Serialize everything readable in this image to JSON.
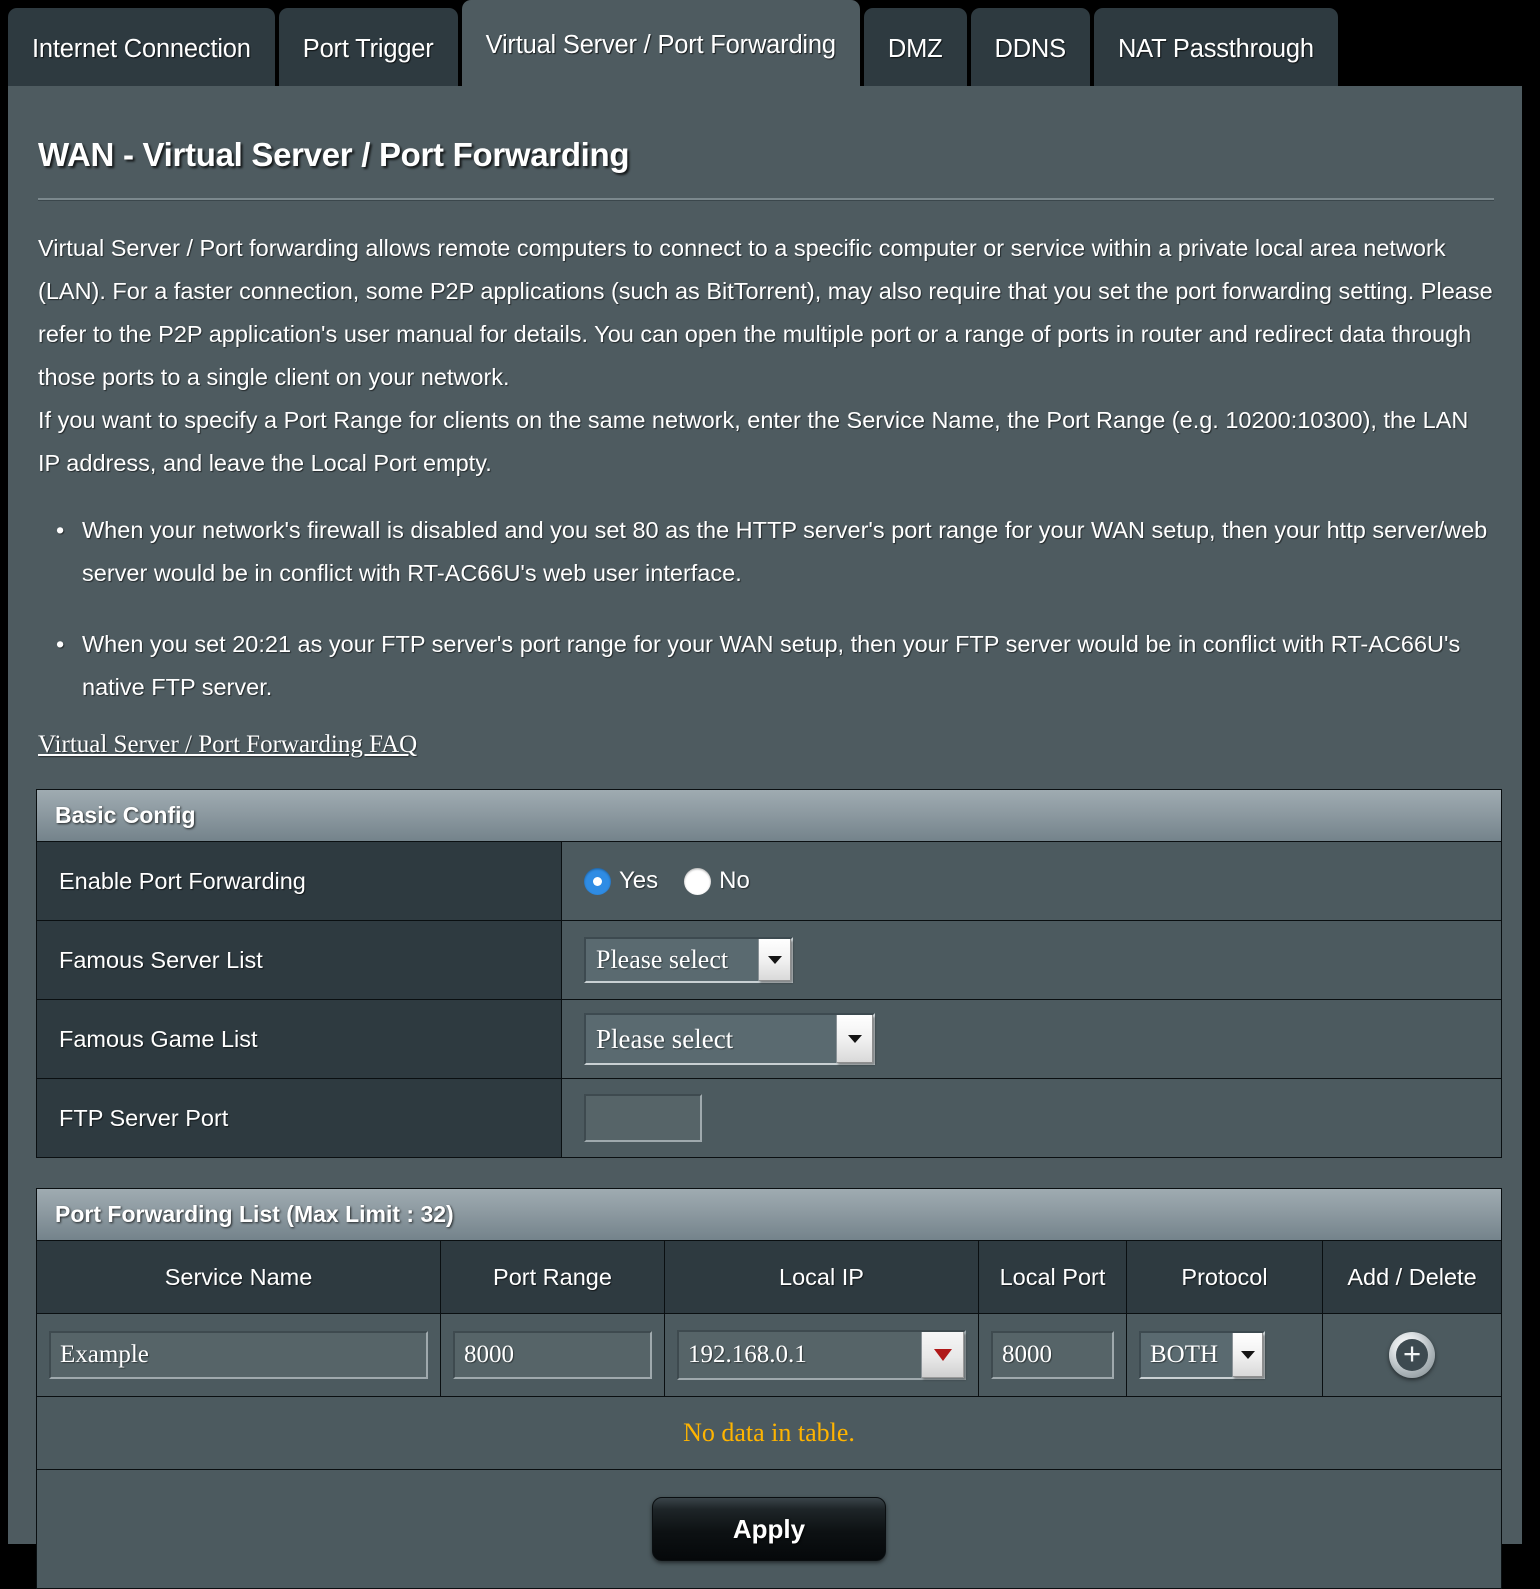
{
  "tabs": [
    {
      "label": "Internet Connection",
      "active": false
    },
    {
      "label": "Port Trigger",
      "active": false
    },
    {
      "label": "Virtual Server / Port Forwarding",
      "active": true
    },
    {
      "label": "DMZ",
      "active": false
    },
    {
      "label": "DDNS",
      "active": false
    },
    {
      "label": "NAT Passthrough",
      "active": false
    }
  ],
  "page": {
    "title": "WAN - Virtual Server / Port Forwarding",
    "paragraph1": "Virtual Server / Port forwarding allows remote computers to connect to a specific computer or service within a private local area network (LAN). For a faster connection, some P2P applications (such as BitTorrent), may also require that you set the port forwarding setting. Please refer to the P2P application's user manual for details. You can open the multiple port or a range of ports in router and redirect data through those ports to a single client on your network.",
    "paragraph2": "If you want to specify a Port Range for clients on the same network, enter the Service Name, the Port Range (e.g. 10200:10300), the LAN IP address, and leave the Local Port empty.",
    "notes": [
      "When your network's firewall is disabled and you set 80 as the HTTP server's port range for your WAN setup, then your http server/web server would be in conflict with RT-AC66U's web user interface.",
      "When you set 20:21 as your FTP server's port range for your WAN setup, then your FTP server would be in conflict with RT-AC66U's native FTP server."
    ],
    "faq_link": "Virtual Server / Port Forwarding FAQ"
  },
  "basic_config": {
    "heading": "Basic Config",
    "enable_label": "Enable Port Forwarding",
    "enable_options": [
      {
        "label": "Yes",
        "selected": true
      },
      {
        "label": "No",
        "selected": false
      }
    ],
    "famous_server_label": "Famous Server List",
    "famous_server_value": "Please select",
    "famous_game_label": "Famous Game List",
    "famous_game_value": "Please select",
    "ftp_port_label": "FTP Server Port",
    "ftp_port_value": ""
  },
  "port_forwarding_list": {
    "heading": "Port Forwarding List (Max Limit : 32)",
    "columns": [
      "Service Name",
      "Port Range",
      "Local IP",
      "Local Port",
      "Protocol",
      "Add / Delete"
    ],
    "entry_row": {
      "service_name": "Example",
      "port_range": "8000",
      "local_ip": "192.168.0.1",
      "local_port": "8000",
      "protocol": "BOTH",
      "add_icon": "plus-circle-icon"
    },
    "empty_message": "No data in table."
  },
  "footer": {
    "apply_label": "Apply"
  },
  "colors": {
    "panel_bg": "#4e5b60",
    "tab_inactive": "#2e3a40",
    "tab_active": "#4e5b60",
    "label_cell": "#2e3a40",
    "radio_selected": "#2f8ce4",
    "warning_text": "#ffb400",
    "ip_arrow": "#b01818"
  }
}
